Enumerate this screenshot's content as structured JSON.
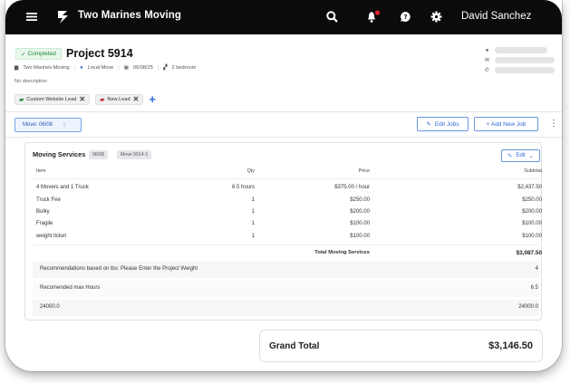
{
  "app": {
    "name": "Two Marines Moving",
    "user": "David Sanchez"
  },
  "icons": [
    "menu-icon",
    "logo-icon",
    "search-icon",
    "bell-icon",
    "help-icon",
    "gear-icon",
    "user-icon",
    "mail-icon",
    "phone-icon",
    "building-icon",
    "calendar-icon",
    "home-icon",
    "pencil-icon",
    "chevron-down-icon"
  ],
  "colors": {
    "accent": "#2f6bd8",
    "status_green": "#1e8a37",
    "notification": "#e0242a"
  },
  "project": {
    "status": "Completed",
    "title": "Project 5914",
    "company": "Two Marines Moving",
    "move_type": "Local Move",
    "date": "06/08/25",
    "rooms": "2 bedroom",
    "description": "No description",
    "tags": [
      {
        "label": "Custom Website Lead"
      },
      {
        "label": "New Lead"
      }
    ]
  },
  "toolbar": {
    "move_tab": "Move: 06/08",
    "edit_jobs": "Edit Jobs",
    "add_new_job": "+ Add New Job"
  },
  "services": {
    "title": "Moving Services",
    "date_chip": "06/08",
    "move_chip": "Move 5914-1",
    "edit_label": "Edit",
    "columns": {
      "item": "Item",
      "qty": "Qty",
      "price": "Price",
      "subtotal": "Subtotal"
    },
    "rows": [
      {
        "item": "4 Movers and 1 Truck",
        "qty": "6.5 hours",
        "price": "$375.00 / hour",
        "subtotal": "$2,437.50"
      },
      {
        "item": "Truck Fee",
        "qty": "1",
        "price": "$250.00",
        "subtotal": "$250.00"
      },
      {
        "item": "Bulky",
        "qty": "1",
        "price": "$200.00",
        "subtotal": "$200.00"
      },
      {
        "item": "Fragile",
        "qty": "1",
        "price": "$100.00",
        "subtotal": "$100.00"
      },
      {
        "item": "weight ticket",
        "qty": "1",
        "price": "$100.00",
        "subtotal": "$100.00"
      }
    ],
    "total_label": "Total Moving Services",
    "total_value": "$3,087.50",
    "recommendations": [
      {
        "label": "Recommendations based on lbs: Please Enter the Project Weight",
        "value": "4"
      },
      {
        "label": "Recomended max Hours",
        "value": "6.5"
      },
      {
        "label": "24000.0",
        "value": "24000.0"
      }
    ]
  },
  "grand_total": {
    "label": "Grand Total",
    "value": "$3,146.50"
  }
}
